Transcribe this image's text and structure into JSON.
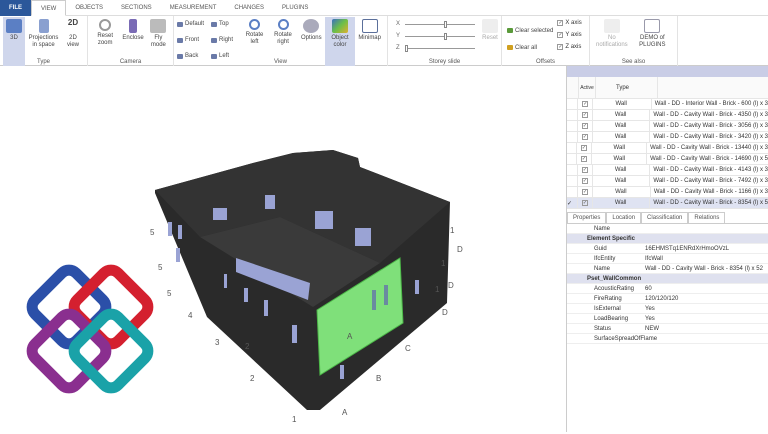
{
  "tabs": [
    "FILE",
    "VIEW",
    "OBJECTS",
    "SECTIONS",
    "MEASUREMENT",
    "CHANGES",
    "PLUGINS"
  ],
  "ribbon": {
    "type": {
      "label": "Type",
      "buttons": [
        "3D",
        "Projections in space",
        "2D view"
      ]
    },
    "camera": {
      "label": "Camera",
      "buttons": [
        "Reset zoom",
        "Enclose",
        "Fly mode"
      ]
    },
    "view": {
      "label": "View",
      "small": [
        "Default",
        "Top",
        "Front",
        "Right",
        "Back",
        "Left"
      ],
      "buttons": [
        "Rotate left",
        "Rotate right",
        "Options",
        "Object color",
        "Minimap"
      ]
    },
    "storey": {
      "label": "Storey slide",
      "axes": [
        "X",
        "Y",
        "Z"
      ],
      "values": [
        0.55,
        0.55,
        0.0
      ],
      "reset": "Reset"
    },
    "offsets": {
      "label": "Offsets",
      "clear_selected": "Clear selected",
      "clear_all": "Clear all",
      "checks": [
        "X axis",
        "Y axis",
        "Z axis"
      ]
    },
    "see_also": {
      "label": "See also",
      "notifications": "No notifications",
      "demo": "DEMO of PLUGINS"
    }
  },
  "grid": {
    "headers": [
      "Active",
      "Type"
    ],
    "rows": [
      {
        "type": "Wall",
        "name": "Wall - DD - Interior Wall - Brick - 600 (l) x 3"
      },
      {
        "type": "Wall",
        "name": "Wall - DD - Cavity Wall - Brick - 4350 (l) x 3"
      },
      {
        "type": "Wall",
        "name": "Wall - DD - Cavity Wall - Brick - 3056 (l) x 3"
      },
      {
        "type": "Wall",
        "name": "Wall - DD - Cavity Wall - Brick - 3420 (l) x 3"
      },
      {
        "type": "Wall",
        "name": "Wall - DD - Cavity Wall - Brick - 13440 (l) x 3"
      },
      {
        "type": "Wall",
        "name": "Wall - DD - Cavity Wall - Brick - 14690 (l) x 5"
      },
      {
        "type": "Wall",
        "name": "Wall - DD - Cavity Wall - Brick - 4143 (l) x 3"
      },
      {
        "type": "Wall",
        "name": "Wall - DD - Cavity Wall - Brick - 7492 (l) x 3"
      },
      {
        "type": "Wall",
        "name": "Wall - DD - Cavity Wall - Brick - 1166 (l) x 3"
      },
      {
        "type": "Wall",
        "name": "Wall - DD - Cavity Wall - Brick - 8354 (l) x 5"
      }
    ]
  },
  "props": {
    "tabs": [
      "Properties",
      "Location",
      "Classification",
      "Relations"
    ],
    "header": "Name",
    "sections": [
      {
        "title": "Element Specific",
        "rows": [
          [
            "Guid",
            "16EHMSTq1ENRdXrHmoOVzL"
          ],
          [
            "IfcEntity",
            "IfcWall"
          ],
          [
            "Name",
            "Wall - DD - Cavity Wall - Brick - 8354 (l) x 52"
          ]
        ]
      },
      {
        "title": "Pset_WallCommon",
        "rows": [
          [
            "AcousticRating",
            "60"
          ],
          [
            "FireRating",
            "120/120/120"
          ],
          [
            "IsExternal",
            "Yes"
          ],
          [
            "LoadBearing",
            "Yes"
          ],
          [
            "Status",
            "NEW"
          ],
          [
            "SurfaceSpreadOfFlame",
            ""
          ]
        ]
      }
    ]
  },
  "grid_labels": [
    "5",
    "5",
    "5",
    "4",
    "3",
    "2",
    "2",
    "1",
    "A",
    "B",
    "C",
    "D",
    "D",
    "D",
    "1",
    "1",
    "1",
    "A"
  ],
  "colors": {
    "accent": "#2b579a",
    "selected": "#7fe07a",
    "building": "#2a2a2a"
  }
}
